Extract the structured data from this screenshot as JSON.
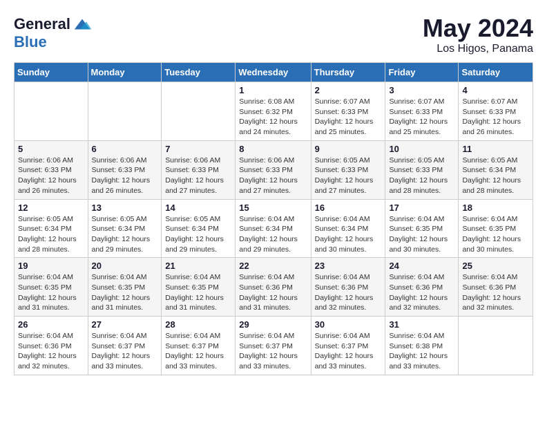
{
  "header": {
    "logo_line1": "General",
    "logo_line2": "Blue",
    "month": "May 2024",
    "location": "Los Higos, Panama"
  },
  "weekdays": [
    "Sunday",
    "Monday",
    "Tuesday",
    "Wednesday",
    "Thursday",
    "Friday",
    "Saturday"
  ],
  "weeks": [
    [
      {
        "day": "",
        "info": ""
      },
      {
        "day": "",
        "info": ""
      },
      {
        "day": "",
        "info": ""
      },
      {
        "day": "1",
        "info": "Sunrise: 6:08 AM\nSunset: 6:32 PM\nDaylight: 12 hours\nand 24 minutes."
      },
      {
        "day": "2",
        "info": "Sunrise: 6:07 AM\nSunset: 6:33 PM\nDaylight: 12 hours\nand 25 minutes."
      },
      {
        "day": "3",
        "info": "Sunrise: 6:07 AM\nSunset: 6:33 PM\nDaylight: 12 hours\nand 25 minutes."
      },
      {
        "day": "4",
        "info": "Sunrise: 6:07 AM\nSunset: 6:33 PM\nDaylight: 12 hours\nand 26 minutes."
      }
    ],
    [
      {
        "day": "5",
        "info": "Sunrise: 6:06 AM\nSunset: 6:33 PM\nDaylight: 12 hours\nand 26 minutes."
      },
      {
        "day": "6",
        "info": "Sunrise: 6:06 AM\nSunset: 6:33 PM\nDaylight: 12 hours\nand 26 minutes."
      },
      {
        "day": "7",
        "info": "Sunrise: 6:06 AM\nSunset: 6:33 PM\nDaylight: 12 hours\nand 27 minutes."
      },
      {
        "day": "8",
        "info": "Sunrise: 6:06 AM\nSunset: 6:33 PM\nDaylight: 12 hours\nand 27 minutes."
      },
      {
        "day": "9",
        "info": "Sunrise: 6:05 AM\nSunset: 6:33 PM\nDaylight: 12 hours\nand 27 minutes."
      },
      {
        "day": "10",
        "info": "Sunrise: 6:05 AM\nSunset: 6:33 PM\nDaylight: 12 hours\nand 28 minutes."
      },
      {
        "day": "11",
        "info": "Sunrise: 6:05 AM\nSunset: 6:34 PM\nDaylight: 12 hours\nand 28 minutes."
      }
    ],
    [
      {
        "day": "12",
        "info": "Sunrise: 6:05 AM\nSunset: 6:34 PM\nDaylight: 12 hours\nand 28 minutes."
      },
      {
        "day": "13",
        "info": "Sunrise: 6:05 AM\nSunset: 6:34 PM\nDaylight: 12 hours\nand 29 minutes."
      },
      {
        "day": "14",
        "info": "Sunrise: 6:05 AM\nSunset: 6:34 PM\nDaylight: 12 hours\nand 29 minutes."
      },
      {
        "day": "15",
        "info": "Sunrise: 6:04 AM\nSunset: 6:34 PM\nDaylight: 12 hours\nand 29 minutes."
      },
      {
        "day": "16",
        "info": "Sunrise: 6:04 AM\nSunset: 6:34 PM\nDaylight: 12 hours\nand 30 minutes."
      },
      {
        "day": "17",
        "info": "Sunrise: 6:04 AM\nSunset: 6:35 PM\nDaylight: 12 hours\nand 30 minutes."
      },
      {
        "day": "18",
        "info": "Sunrise: 6:04 AM\nSunset: 6:35 PM\nDaylight: 12 hours\nand 30 minutes."
      }
    ],
    [
      {
        "day": "19",
        "info": "Sunrise: 6:04 AM\nSunset: 6:35 PM\nDaylight: 12 hours\nand 31 minutes."
      },
      {
        "day": "20",
        "info": "Sunrise: 6:04 AM\nSunset: 6:35 PM\nDaylight: 12 hours\nand 31 minutes."
      },
      {
        "day": "21",
        "info": "Sunrise: 6:04 AM\nSunset: 6:35 PM\nDaylight: 12 hours\nand 31 minutes."
      },
      {
        "day": "22",
        "info": "Sunrise: 6:04 AM\nSunset: 6:36 PM\nDaylight: 12 hours\nand 31 minutes."
      },
      {
        "day": "23",
        "info": "Sunrise: 6:04 AM\nSunset: 6:36 PM\nDaylight: 12 hours\nand 32 minutes."
      },
      {
        "day": "24",
        "info": "Sunrise: 6:04 AM\nSunset: 6:36 PM\nDaylight: 12 hours\nand 32 minutes."
      },
      {
        "day": "25",
        "info": "Sunrise: 6:04 AM\nSunset: 6:36 PM\nDaylight: 12 hours\nand 32 minutes."
      }
    ],
    [
      {
        "day": "26",
        "info": "Sunrise: 6:04 AM\nSunset: 6:36 PM\nDaylight: 12 hours\nand 32 minutes."
      },
      {
        "day": "27",
        "info": "Sunrise: 6:04 AM\nSunset: 6:37 PM\nDaylight: 12 hours\nand 33 minutes."
      },
      {
        "day": "28",
        "info": "Sunrise: 6:04 AM\nSunset: 6:37 PM\nDaylight: 12 hours\nand 33 minutes."
      },
      {
        "day": "29",
        "info": "Sunrise: 6:04 AM\nSunset: 6:37 PM\nDaylight: 12 hours\nand 33 minutes."
      },
      {
        "day": "30",
        "info": "Sunrise: 6:04 AM\nSunset: 6:37 PM\nDaylight: 12 hours\nand 33 minutes."
      },
      {
        "day": "31",
        "info": "Sunrise: 6:04 AM\nSunset: 6:38 PM\nDaylight: 12 hours\nand 33 minutes."
      },
      {
        "day": "",
        "info": ""
      }
    ]
  ]
}
